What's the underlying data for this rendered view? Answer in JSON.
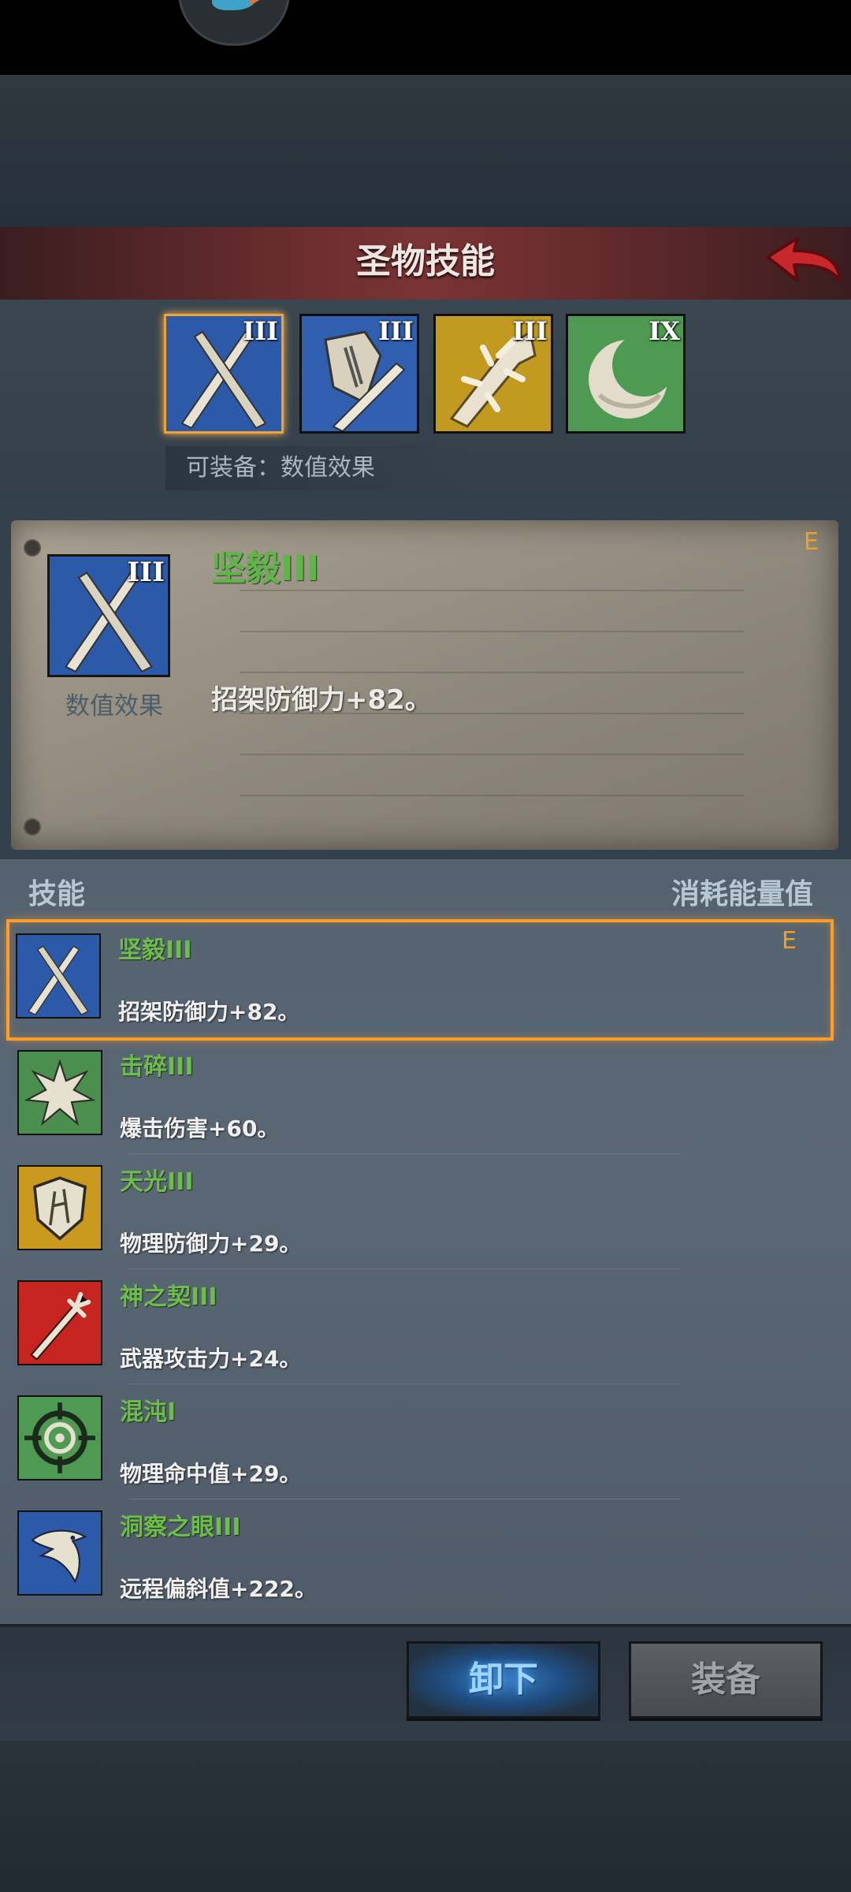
{
  "header": {
    "title": "圣物技能"
  },
  "relics": [
    {
      "icon": "crossed-swords-icon",
      "rank": "III",
      "selected": true
    },
    {
      "icon": "shield-sword-icon",
      "rank": "III",
      "selected": false
    },
    {
      "icon": "spiked-club-icon",
      "rank": "III",
      "selected": false
    },
    {
      "icon": "moon-swirl-icon",
      "rank": "IX",
      "selected": false
    }
  ],
  "equip_hint": "可装备：数值效果",
  "detail": {
    "icon": "crossed-swords-icon",
    "rank": "III",
    "category": "数值效果",
    "name": "坚毅III",
    "description": "招架防御力+82。",
    "tag": "E"
  },
  "list": {
    "header_left": "技能",
    "header_right": "消耗能量值",
    "items": [
      {
        "name": "坚毅III",
        "desc": "招架防御力+82。",
        "tag": "E",
        "icon": "crossed-swords-icon",
        "selected": true
      },
      {
        "name": "击碎III",
        "desc": "爆击伤害+60。",
        "tag": "",
        "icon": "burst-icon",
        "selected": false
      },
      {
        "name": "天光III",
        "desc": "物理防御力+29。",
        "tag": "",
        "icon": "shield-icon",
        "selected": false
      },
      {
        "name": "神之契III",
        "desc": "武器攻击力+24。",
        "tag": "",
        "icon": "sword-icon",
        "selected": false
      },
      {
        "name": "混沌I",
        "desc": "物理命中值+29。",
        "tag": "",
        "icon": "crosshair-icon",
        "selected": false
      },
      {
        "name": "洞察之眼III",
        "desc": "远程偏斜值+222。",
        "tag": "",
        "icon": "eagle-icon",
        "selected": false
      }
    ]
  },
  "buttons": {
    "unequip": "卸下",
    "equip": "装备"
  },
  "colors": {
    "accent_orange": "#ff9c2a",
    "skill_green": "#6dbd4c",
    "header_red": "#7a3434",
    "unequip_blue": "#3b7ec6"
  }
}
